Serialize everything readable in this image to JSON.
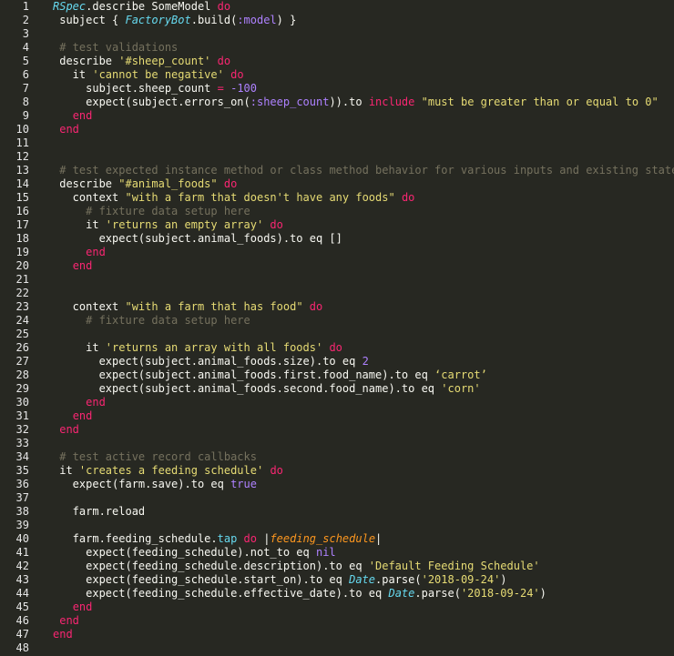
{
  "editor": {
    "language": "ruby",
    "theme_colors": {
      "background": "#272822",
      "plain": "#f8f8f2",
      "keyword": "#f92672",
      "string": "#e6db74",
      "comment": "#75715e",
      "class": "#66d9ef",
      "symbol": "#ae81ff",
      "argument": "#fd971f",
      "line_number": "#e6e6e6"
    },
    "lines": [
      [
        [
          "cls",
          "RSpec"
        ],
        [
          "t",
          ".describe SomeModel "
        ],
        [
          "kw",
          "do"
        ]
      ],
      [
        [
          "t",
          " subject { "
        ],
        [
          "cls",
          "FactoryBot"
        ],
        [
          "t",
          ".build("
        ],
        [
          "sym",
          ":model"
        ],
        [
          "t",
          ") }"
        ]
      ],
      [],
      [
        [
          "t",
          " "
        ],
        [
          "cm",
          "# test validations"
        ]
      ],
      [
        [
          "t",
          " describe "
        ],
        [
          "str",
          "'#sheep_count'"
        ],
        [
          "t",
          " "
        ],
        [
          "kw",
          "do"
        ]
      ],
      [
        [
          "t",
          "   it "
        ],
        [
          "str",
          "'cannot be negative'"
        ],
        [
          "t",
          " "
        ],
        [
          "kw",
          "do"
        ]
      ],
      [
        [
          "t",
          "     subject.sheep_count "
        ],
        [
          "kw",
          "="
        ],
        [
          "t",
          " "
        ],
        [
          "num",
          "-100"
        ]
      ],
      [
        [
          "t",
          "     expect(subject.errors_on("
        ],
        [
          "sym",
          ":sheep_count"
        ],
        [
          "t",
          ")).to "
        ],
        [
          "kw",
          "include"
        ],
        [
          "t",
          " "
        ],
        [
          "str",
          "\"must be greater than or equal to 0\""
        ]
      ],
      [
        [
          "t",
          "   "
        ],
        [
          "kw",
          "end"
        ]
      ],
      [
        [
          "t",
          " "
        ],
        [
          "kw",
          "end"
        ]
      ],
      [],
      [],
      [
        [
          "t",
          " "
        ],
        [
          "cm",
          "# test expected instance method or class method behavior for various inputs and existing states"
        ]
      ],
      [
        [
          "t",
          " describe "
        ],
        [
          "str",
          "\"#animal_foods\""
        ],
        [
          "t",
          " "
        ],
        [
          "kw",
          "do"
        ]
      ],
      [
        [
          "t",
          "   context "
        ],
        [
          "str",
          "\"with a farm that doesn't have any foods\""
        ],
        [
          "t",
          " "
        ],
        [
          "kw",
          "do"
        ]
      ],
      [
        [
          "t",
          "     "
        ],
        [
          "cm",
          "# fixture data setup here"
        ]
      ],
      [
        [
          "t",
          "     it "
        ],
        [
          "str",
          "'returns an empty array'"
        ],
        [
          "t",
          " "
        ],
        [
          "kw",
          "do"
        ]
      ],
      [
        [
          "t",
          "       expect(subject.animal_foods).to eq []"
        ]
      ],
      [
        [
          "t",
          "     "
        ],
        [
          "kw",
          "end"
        ]
      ],
      [
        [
          "t",
          "   "
        ],
        [
          "kw",
          "end"
        ]
      ],
      [],
      [],
      [
        [
          "t",
          "   context "
        ],
        [
          "str",
          "\"with a farm that has food\""
        ],
        [
          "t",
          " "
        ],
        [
          "kw",
          "do"
        ]
      ],
      [
        [
          "t",
          "     "
        ],
        [
          "cm",
          "# fixture data setup here"
        ]
      ],
      [],
      [
        [
          "t",
          "     it "
        ],
        [
          "str",
          "'returns an array with all foods'"
        ],
        [
          "t",
          " "
        ],
        [
          "kw",
          "do"
        ]
      ],
      [
        [
          "t",
          "       expect(subject.animal_foods.size).to eq "
        ],
        [
          "num",
          "2"
        ]
      ],
      [
        [
          "t",
          "       expect(subject.animal_foods.first.food_name).to eq "
        ],
        [
          "str",
          "‘carrot’"
        ]
      ],
      [
        [
          "t",
          "       expect(subject.animal_foods.second.food_name).to eq "
        ],
        [
          "str",
          "'corn'"
        ]
      ],
      [
        [
          "t",
          "     "
        ],
        [
          "kw",
          "end"
        ]
      ],
      [
        [
          "t",
          "   "
        ],
        [
          "kw",
          "end"
        ]
      ],
      [
        [
          "t",
          " "
        ],
        [
          "kw",
          "end"
        ]
      ],
      [],
      [
        [
          "t",
          " "
        ],
        [
          "cm",
          "# test active record callbacks"
        ]
      ],
      [
        [
          "t",
          " it "
        ],
        [
          "str",
          "'creates a feeding schedule'"
        ],
        [
          "t",
          " "
        ],
        [
          "kw",
          "do"
        ]
      ],
      [
        [
          "t",
          "   expect(farm.save).to eq "
        ],
        [
          "num",
          "true"
        ]
      ],
      [],
      [
        [
          "t",
          "   farm.reload"
        ]
      ],
      [],
      [
        [
          "t",
          "   farm.feeding_schedule."
        ],
        [
          "fn",
          "tap"
        ],
        [
          "t",
          " "
        ],
        [
          "kw",
          "do"
        ],
        [
          "t",
          " |"
        ],
        [
          "arg",
          "feeding_schedule"
        ],
        [
          "t",
          "|"
        ]
      ],
      [
        [
          "t",
          "     expect(feeding_schedule).not_to eq "
        ],
        [
          "num",
          "nil"
        ]
      ],
      [
        [
          "t",
          "     expect(feeding_schedule.description).to eq "
        ],
        [
          "str",
          "'Default Feeding Schedule'"
        ]
      ],
      [
        [
          "t",
          "     expect(feeding_schedule.start_on).to eq "
        ],
        [
          "cls",
          "Date"
        ],
        [
          "t",
          ".parse("
        ],
        [
          "str",
          "'2018-09-24'"
        ],
        [
          "t",
          ")"
        ]
      ],
      [
        [
          "t",
          "     expect(feeding_schedule.effective_date).to eq "
        ],
        [
          "cls",
          "Date"
        ],
        [
          "t",
          ".parse("
        ],
        [
          "str",
          "'2018-09-24'"
        ],
        [
          "t",
          ")"
        ]
      ],
      [
        [
          "t",
          "   "
        ],
        [
          "kw",
          "end"
        ]
      ],
      [
        [
          "t",
          " "
        ],
        [
          "kw",
          "end"
        ]
      ],
      [
        [
          "kw",
          "end"
        ]
      ],
      []
    ]
  }
}
